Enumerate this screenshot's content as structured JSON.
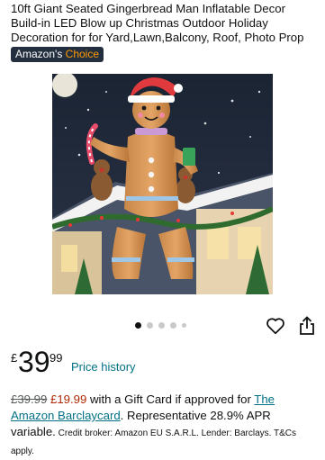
{
  "product": {
    "title": "10ft Giant Seated Gingerbread Man Inflatable Decor Build-in LED Blow up Christmas Outdoor Holiday Decoration for for Yard,Lawn,Balcony, Roof, Photo Prop",
    "badge_prefix": "Amazon's ",
    "badge_accent": "Choice"
  },
  "gallery": {
    "dot_count": 5,
    "active_index": 0
  },
  "actions": {
    "favorite_icon": "heart-icon",
    "share_icon": "share-icon"
  },
  "price": {
    "currency": "£",
    "whole": "39",
    "fraction": "99",
    "history_link": "Price history"
  },
  "offer": {
    "old_price": "£39.99",
    "new_price": "£19.99",
    "gift_text": " with a Gift Card if approved for ",
    "card_link": "The Amazon Barclaycard",
    "apr_text": ". Representative 28.9% APR variable.",
    "fine_print": " Credit broker: Amazon EU S.A.R.L. Lender: Barclays. T&Cs apply."
  },
  "colors": {
    "link": "#007185",
    "sale": "#b12704",
    "badge_bg": "#232f3e",
    "badge_accent": "#ff9900"
  }
}
